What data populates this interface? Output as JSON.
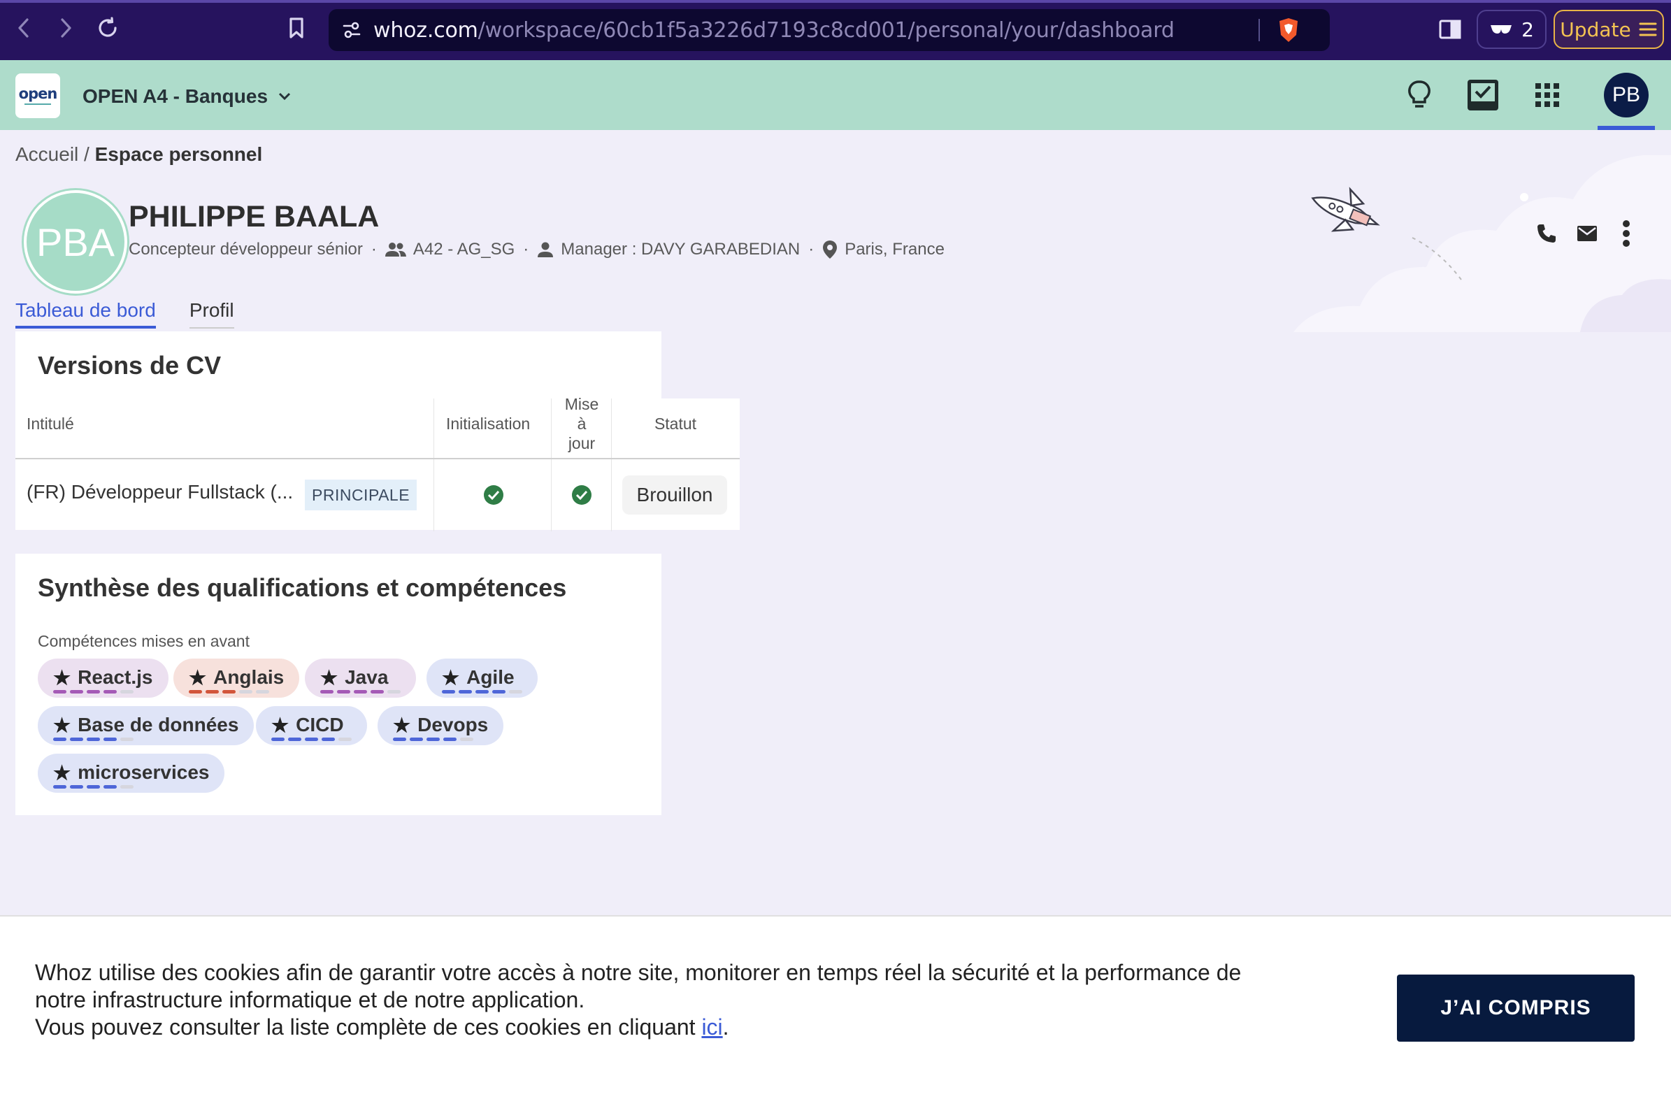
{
  "browser": {
    "url_host": "whoz.com",
    "url_path": "/workspace/60cb1f5a3226d7193c8cd001/personal/your/dashboard",
    "glasses_count": "2",
    "update_label": "Update"
  },
  "header": {
    "logo_text": "open",
    "workspace_name": "OPEN A4 - Banques",
    "avatar_initials": "PB"
  },
  "breadcrumb": {
    "home": "Accueil",
    "separator": " / ",
    "current": "Espace personnel"
  },
  "profile": {
    "initials": "PBA",
    "name": "PHILIPPE BAALA",
    "job_title": "Concepteur développeur sénior",
    "team": "A42 - AG_SG",
    "manager": "Manager : DAVY GARABEDIAN",
    "location": "Paris, France",
    "separator": "·"
  },
  "tabs": {
    "dashboard": "Tableau de bord",
    "profile": "Profil"
  },
  "cv_versions": {
    "title": "Versions de CV",
    "columns": {
      "title": "Intitulé",
      "init": "Initialisation",
      "update_1": "Mise",
      "update_2": "à",
      "update_3": "jour",
      "status": "Statut"
    },
    "rows": [
      {
        "title": "(FR) Développeur Fullstack (...",
        "badge": "PRINCIPALE",
        "initialized": true,
        "updated": true,
        "status": "Brouillon"
      }
    ]
  },
  "skills": {
    "title": "Synthèse des qualifications et compétences",
    "subtitle": "Compétences mises en avant",
    "items": [
      {
        "label": "React.js",
        "level": 4,
        "max": 5,
        "bg": "#ece0f0",
        "bar": "#a55ab6"
      },
      {
        "label": "Anglais",
        "level": 3,
        "max": 5,
        "bg": "#f7e1dc",
        "bar": "#d2553a"
      },
      {
        "label": "Java",
        "level": 4,
        "max": 5,
        "bg": "#ece0f0",
        "bar": "#a55ab6"
      },
      {
        "label": "Agile",
        "level": 4,
        "max": 5,
        "bg": "#dfe4f7",
        "bar": "#4e66d8"
      },
      {
        "label": "Base de données",
        "level": 4,
        "max": 5,
        "bg": "#dfe4f7",
        "bar": "#4e66d8"
      },
      {
        "label": "CICD",
        "level": 4,
        "max": 5,
        "bg": "#dfe4f7",
        "bar": "#4e66d8"
      },
      {
        "label": "Devops",
        "level": 4,
        "max": 5,
        "bg": "#dfe4f7",
        "bar": "#4e66d8"
      },
      {
        "label": "microservices",
        "level": 4,
        "max": 5,
        "bg": "#dfe4f7",
        "bar": "#4e66d8"
      }
    ]
  },
  "cookie": {
    "line1": "Whoz utilise des cookies afin de garantir votre accès à notre site, monitorer en temps réel la sécurité et la performance de notre infrastructure informatique et de notre application.",
    "line2_prefix": "Vous pouvez consulter la liste complète de ces cookies en cliquant ",
    "link": "ici",
    "line2_suffix": ".",
    "button": "J’AI COMPRIS"
  },
  "colors": {
    "accent": "#3b5bd6",
    "header_bg": "#aedccb",
    "browser_bg": "#26135e",
    "cookie_button": "#071a3e"
  }
}
